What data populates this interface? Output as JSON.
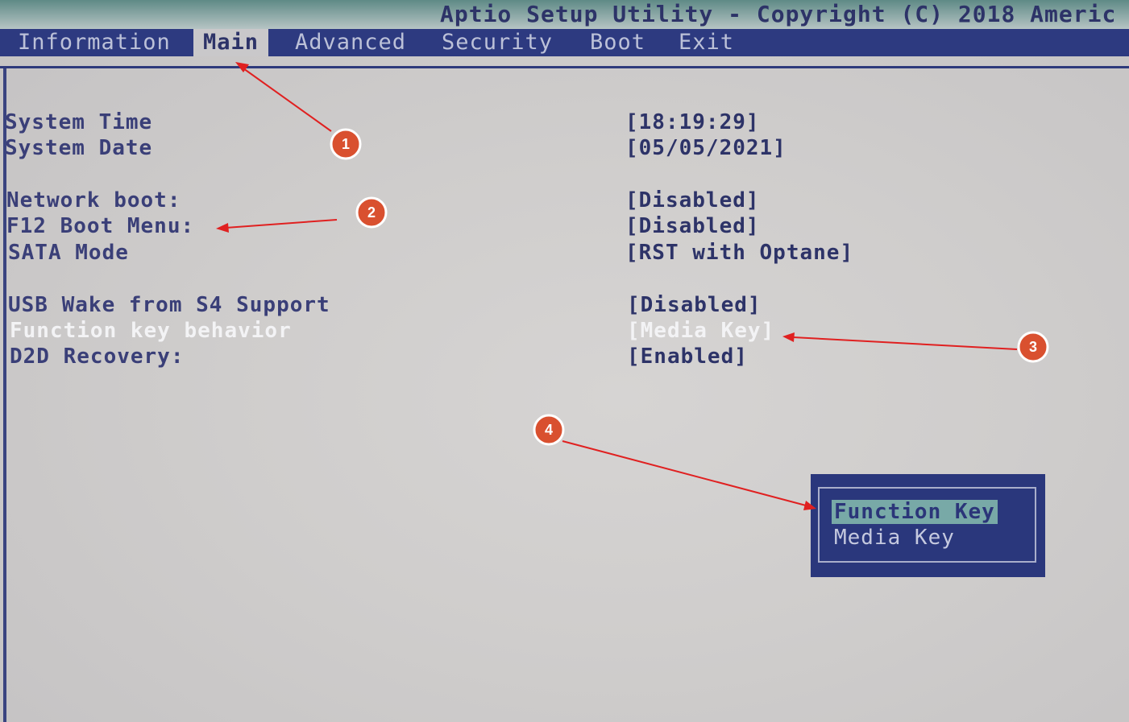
{
  "title": "Aptio Setup Utility - Copyright (C) 2018 Americ",
  "tabs": [
    {
      "label": "Information",
      "active": false
    },
    {
      "label": "Main",
      "active": true
    },
    {
      "label": "Advanced",
      "active": false
    },
    {
      "label": "Security",
      "active": false
    },
    {
      "label": "Boot",
      "active": false
    },
    {
      "label": "Exit",
      "active": false
    }
  ],
  "settings": [
    {
      "label": "System Time",
      "value": "[18:19:29]"
    },
    {
      "label": "System Date",
      "value": "[05/05/2021]"
    },
    {
      "label": "Network boot:",
      "value": "[Disabled]"
    },
    {
      "label": "F12 Boot Menu:",
      "value": "[Disabled]"
    },
    {
      "label": "SATA Mode",
      "value": "[RST with Optane]"
    },
    {
      "label": "USB Wake from S4 Support",
      "value": "[Disabled]"
    },
    {
      "label": "Function key behavior",
      "value": "[Media Key]",
      "highlighted": true
    },
    {
      "label": "D2D Recovery:",
      "value": "[Enabled]"
    }
  ],
  "popup": {
    "options": [
      "Function Key",
      "Media Key"
    ],
    "selected": "Function Key"
  },
  "annotations": [
    "1",
    "2",
    "3",
    "4"
  ],
  "colors": {
    "menubar": "#2d3a80",
    "screen_bg": "#cfcdcc",
    "label_text": "#3a3f78",
    "highlight_text": "#f3f3f5",
    "popup_bg": "#2a377c",
    "popup_selected_bg": "#78a9a7",
    "annotation_badge": "#d9502f",
    "annotation_arrow": "#e02020"
  }
}
